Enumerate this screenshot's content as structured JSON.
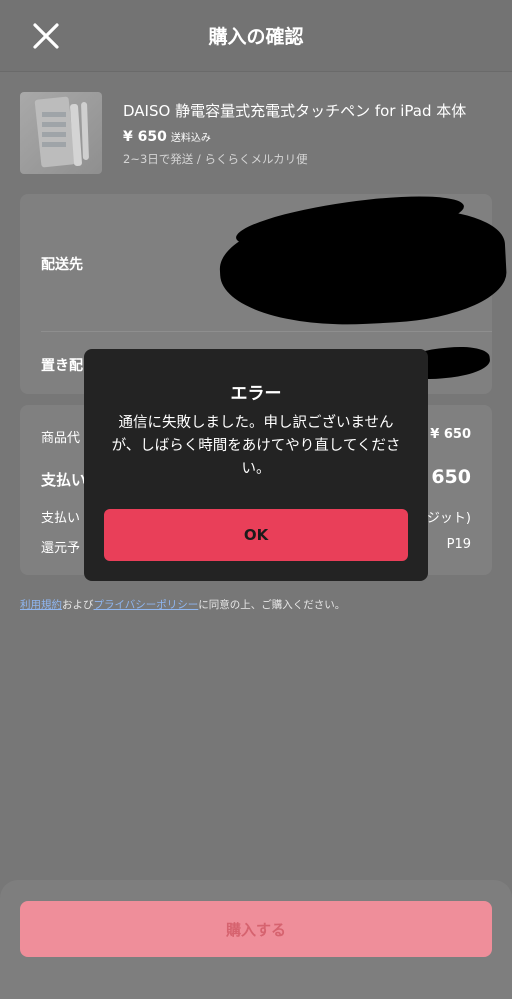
{
  "header": {
    "title": "購入の確認",
    "close_icon": "close-icon"
  },
  "product": {
    "title": "DAISO 静電容量式充電式タッチペン for iPad 本体",
    "price": "¥ 650",
    "shipping_included": "送料込み",
    "shipping_info": "2~3日で発送 / らくらくメルカリ便"
  },
  "delivery": {
    "address_label": "配送先",
    "placement_label": "置き配"
  },
  "summary": {
    "item_price_label": "商品代",
    "item_price_value": "¥ 650",
    "payment_label": "支払い",
    "payment_value": "¥ 650",
    "method_label": "支払い",
    "method_value": "ジット)",
    "points_label": "還元予",
    "points_value": "P19"
  },
  "terms": {
    "terms_link": "利用規約",
    "and": "および",
    "privacy_link": "プライバシーポリシー",
    "suffix": "に同意の上、ご購入ください。"
  },
  "buy_button": {
    "label": "購入する"
  },
  "error_dialog": {
    "title": "エラー",
    "message": "通信に失敗しました。申し訳ございませんが、しばらく時間をあけてやり直してください。",
    "ok_label": "OK"
  },
  "colors": {
    "accent": "#e93f59",
    "overlay_bg": "#777777",
    "modal_bg": "#232323",
    "link": "#8fb6f0"
  }
}
